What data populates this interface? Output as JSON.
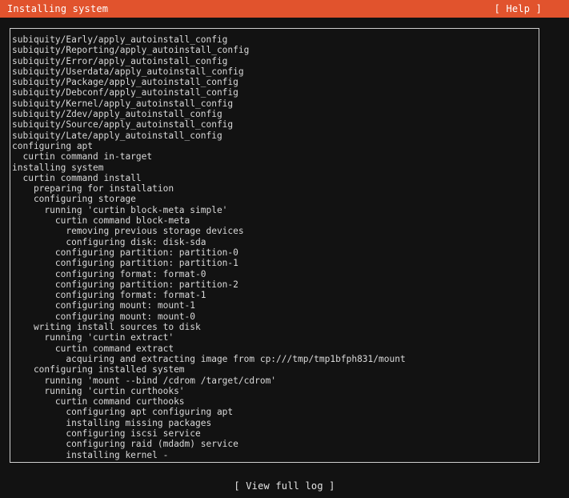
{
  "header": {
    "title": "Installing system",
    "help_label": "[ Help ]"
  },
  "log": {
    "lines": [
      "subiquity/Early/apply_autoinstall_config",
      "subiquity/Reporting/apply_autoinstall_config",
      "subiquity/Error/apply_autoinstall_config",
      "subiquity/Userdata/apply_autoinstall_config",
      "subiquity/Package/apply_autoinstall_config",
      "subiquity/Debconf/apply_autoinstall_config",
      "subiquity/Kernel/apply_autoinstall_config",
      "subiquity/Zdev/apply_autoinstall_config",
      "subiquity/Source/apply_autoinstall_config",
      "subiquity/Late/apply_autoinstall_config",
      "configuring apt",
      "  curtin command in-target",
      "installing system",
      "  curtin command install",
      "    preparing for installation",
      "    configuring storage",
      "      running 'curtin block-meta simple'",
      "        curtin command block-meta",
      "          removing previous storage devices",
      "          configuring disk: disk-sda",
      "        configuring partition: partition-0",
      "        configuring partition: partition-1",
      "        configuring format: format-0",
      "        configuring partition: partition-2",
      "        configuring format: format-1",
      "        configuring mount: mount-1",
      "        configuring mount: mount-0",
      "    writing install sources to disk",
      "      running 'curtin extract'",
      "        curtin command extract",
      "          acquiring and extracting image from cp:///tmp/tmp1bfph831/mount",
      "    configuring installed system",
      "      running 'mount --bind /cdrom /target/cdrom'",
      "      running 'curtin curthooks'",
      "        curtin command curthooks",
      "          configuring apt configuring apt",
      "          installing missing packages",
      "          configuring iscsi service",
      "          configuring raid (mdadm) service",
      "          installing kernel -"
    ]
  },
  "footer": {
    "view_log_label": "[ View full log ]"
  },
  "colors": {
    "header_bg": "#e1532d",
    "page_bg": "#121212",
    "text": "#d9d9d9"
  }
}
